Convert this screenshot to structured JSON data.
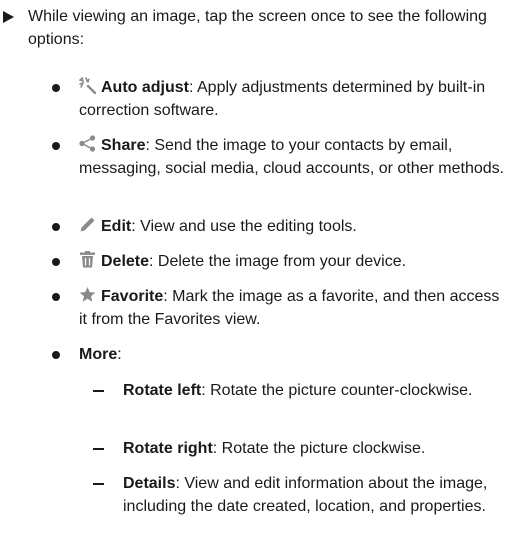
{
  "intro": "While viewing an image, tap the screen once to see the following options:",
  "options": [
    {
      "icon": "auto-adjust-wand-icon",
      "label": "Auto adjust",
      "desc": ": Apply adjustments determined by built-in correction software."
    },
    {
      "icon": "share-icon",
      "label": "Share",
      "desc": ": Send the image to your contacts by email, messaging, social media, cloud accounts, or other methods."
    },
    {
      "icon": "pencil-edit-icon",
      "label": "Edit",
      "desc": ": View and use the editing tools."
    },
    {
      "icon": "trash-icon",
      "label": "Delete",
      "desc": ": Delete the image from your device."
    },
    {
      "icon": "star-icon",
      "label": "Favorite",
      "desc": ": Mark the image as a favorite, and then access it from the Favorites view."
    },
    {
      "label": "More",
      "desc": ":"
    }
  ],
  "more_items": [
    {
      "label": "Rotate left",
      "desc": ": Rotate the picture counter-clockwise."
    },
    {
      "label": "Rotate right",
      "desc": ": Rotate the picture clockwise."
    },
    {
      "label": "Details",
      "desc": ": View and edit information about the image, including the date created, location, and properties."
    }
  ],
  "colors": {
    "text": "#1a1a1a",
    "icon": "#8a8a8a"
  }
}
